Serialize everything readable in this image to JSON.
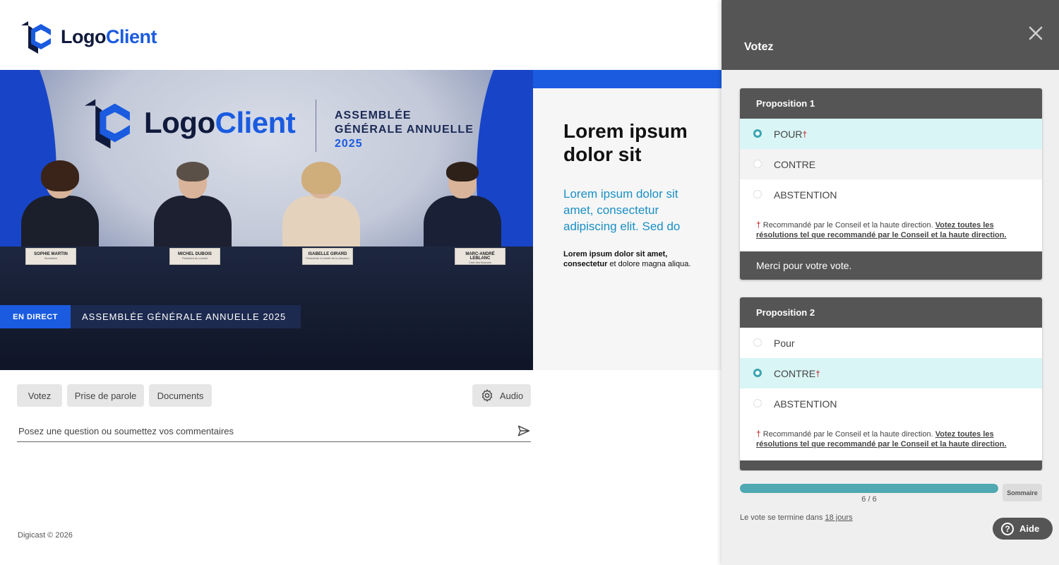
{
  "brand": {
    "logo_part1": "Logo",
    "logo_part2": "Client",
    "colors": {
      "accent": "#1a5be0",
      "teal": "#4fa8b2",
      "panel_dark": "#555555"
    }
  },
  "video": {
    "stage_logo_part1": "Logo",
    "stage_logo_part2": "Client",
    "stage_title_line1": "ASSEMBLÉE",
    "stage_title_line2": "GÉNÉRALE ANNUELLE",
    "stage_title_year": "2025",
    "nameplates": [
      {
        "name": "SOPHIE MARTIN",
        "role": "Secrétaire"
      },
      {
        "name": "MICHEL DUBOIS",
        "role": "Président du conseil"
      },
      {
        "name": "ISABELLE GIRARD",
        "role": "Présidente et cheffe de la direction"
      },
      {
        "name": "MARC-ANDRÉ LEBLANC",
        "role": "Chef des finances"
      }
    ],
    "live_badge": "EN DIRECT",
    "lower_third_title": "ASSEMBLÉE GÉNÉRALE ANNUELLE 2025"
  },
  "slide": {
    "title": "Lorem ipsum dolor sit",
    "subtitle": "Lorem ipsum dolor sit amet, consectetur adipiscing elit. Sed do",
    "small_bold": "Lorem ipsum dolor sit amet, consectetur",
    "small_rest": " et dolore magna aliqua."
  },
  "controls": {
    "votez": "Votez",
    "prise_de_parole": "Prise de parole",
    "documents": "Documents",
    "audio": "Audio",
    "question_placeholder": "Posez une question ou soumettez vos commentaires"
  },
  "footer": {
    "copyright": "Digicast © 2026"
  },
  "panel": {
    "title": "Votez",
    "proposals": [
      {
        "title": "Proposition 1",
        "options": [
          {
            "label": "POUR",
            "recommended": true,
            "selected": true
          },
          {
            "label": "CONTRE",
            "recommended": false,
            "selected": false
          },
          {
            "label": "ABSTENTION",
            "recommended": false,
            "selected": false
          }
        ],
        "rec_text": " Recommandé par le Conseil et la haute direction. ",
        "rec_link": "Votez toutes les résolutions tel que recommandé par le Conseil et la haute direction.",
        "thanks": "Merci pour votre vote."
      },
      {
        "title": "Proposition 2",
        "options": [
          {
            "label": "Pour",
            "recommended": false,
            "selected": false
          },
          {
            "label": "CONTRE",
            "recommended": true,
            "selected": true
          },
          {
            "label": "ABSTENTION",
            "recommended": false,
            "selected": false
          }
        ],
        "rec_text": " Recommandé par le Conseil et la haute direction. ",
        "rec_link": "Votez toutes les résolutions tel que recommandé par le Conseil et la haute direction."
      }
    ],
    "progress": {
      "current": 6,
      "total": 6,
      "label": "6 / 6",
      "fraction": 1.0
    },
    "summary_button": "Sommaire",
    "ends_text": "Le vote se termine dans ",
    "ends_link": "18 jours",
    "help": "Aide"
  }
}
